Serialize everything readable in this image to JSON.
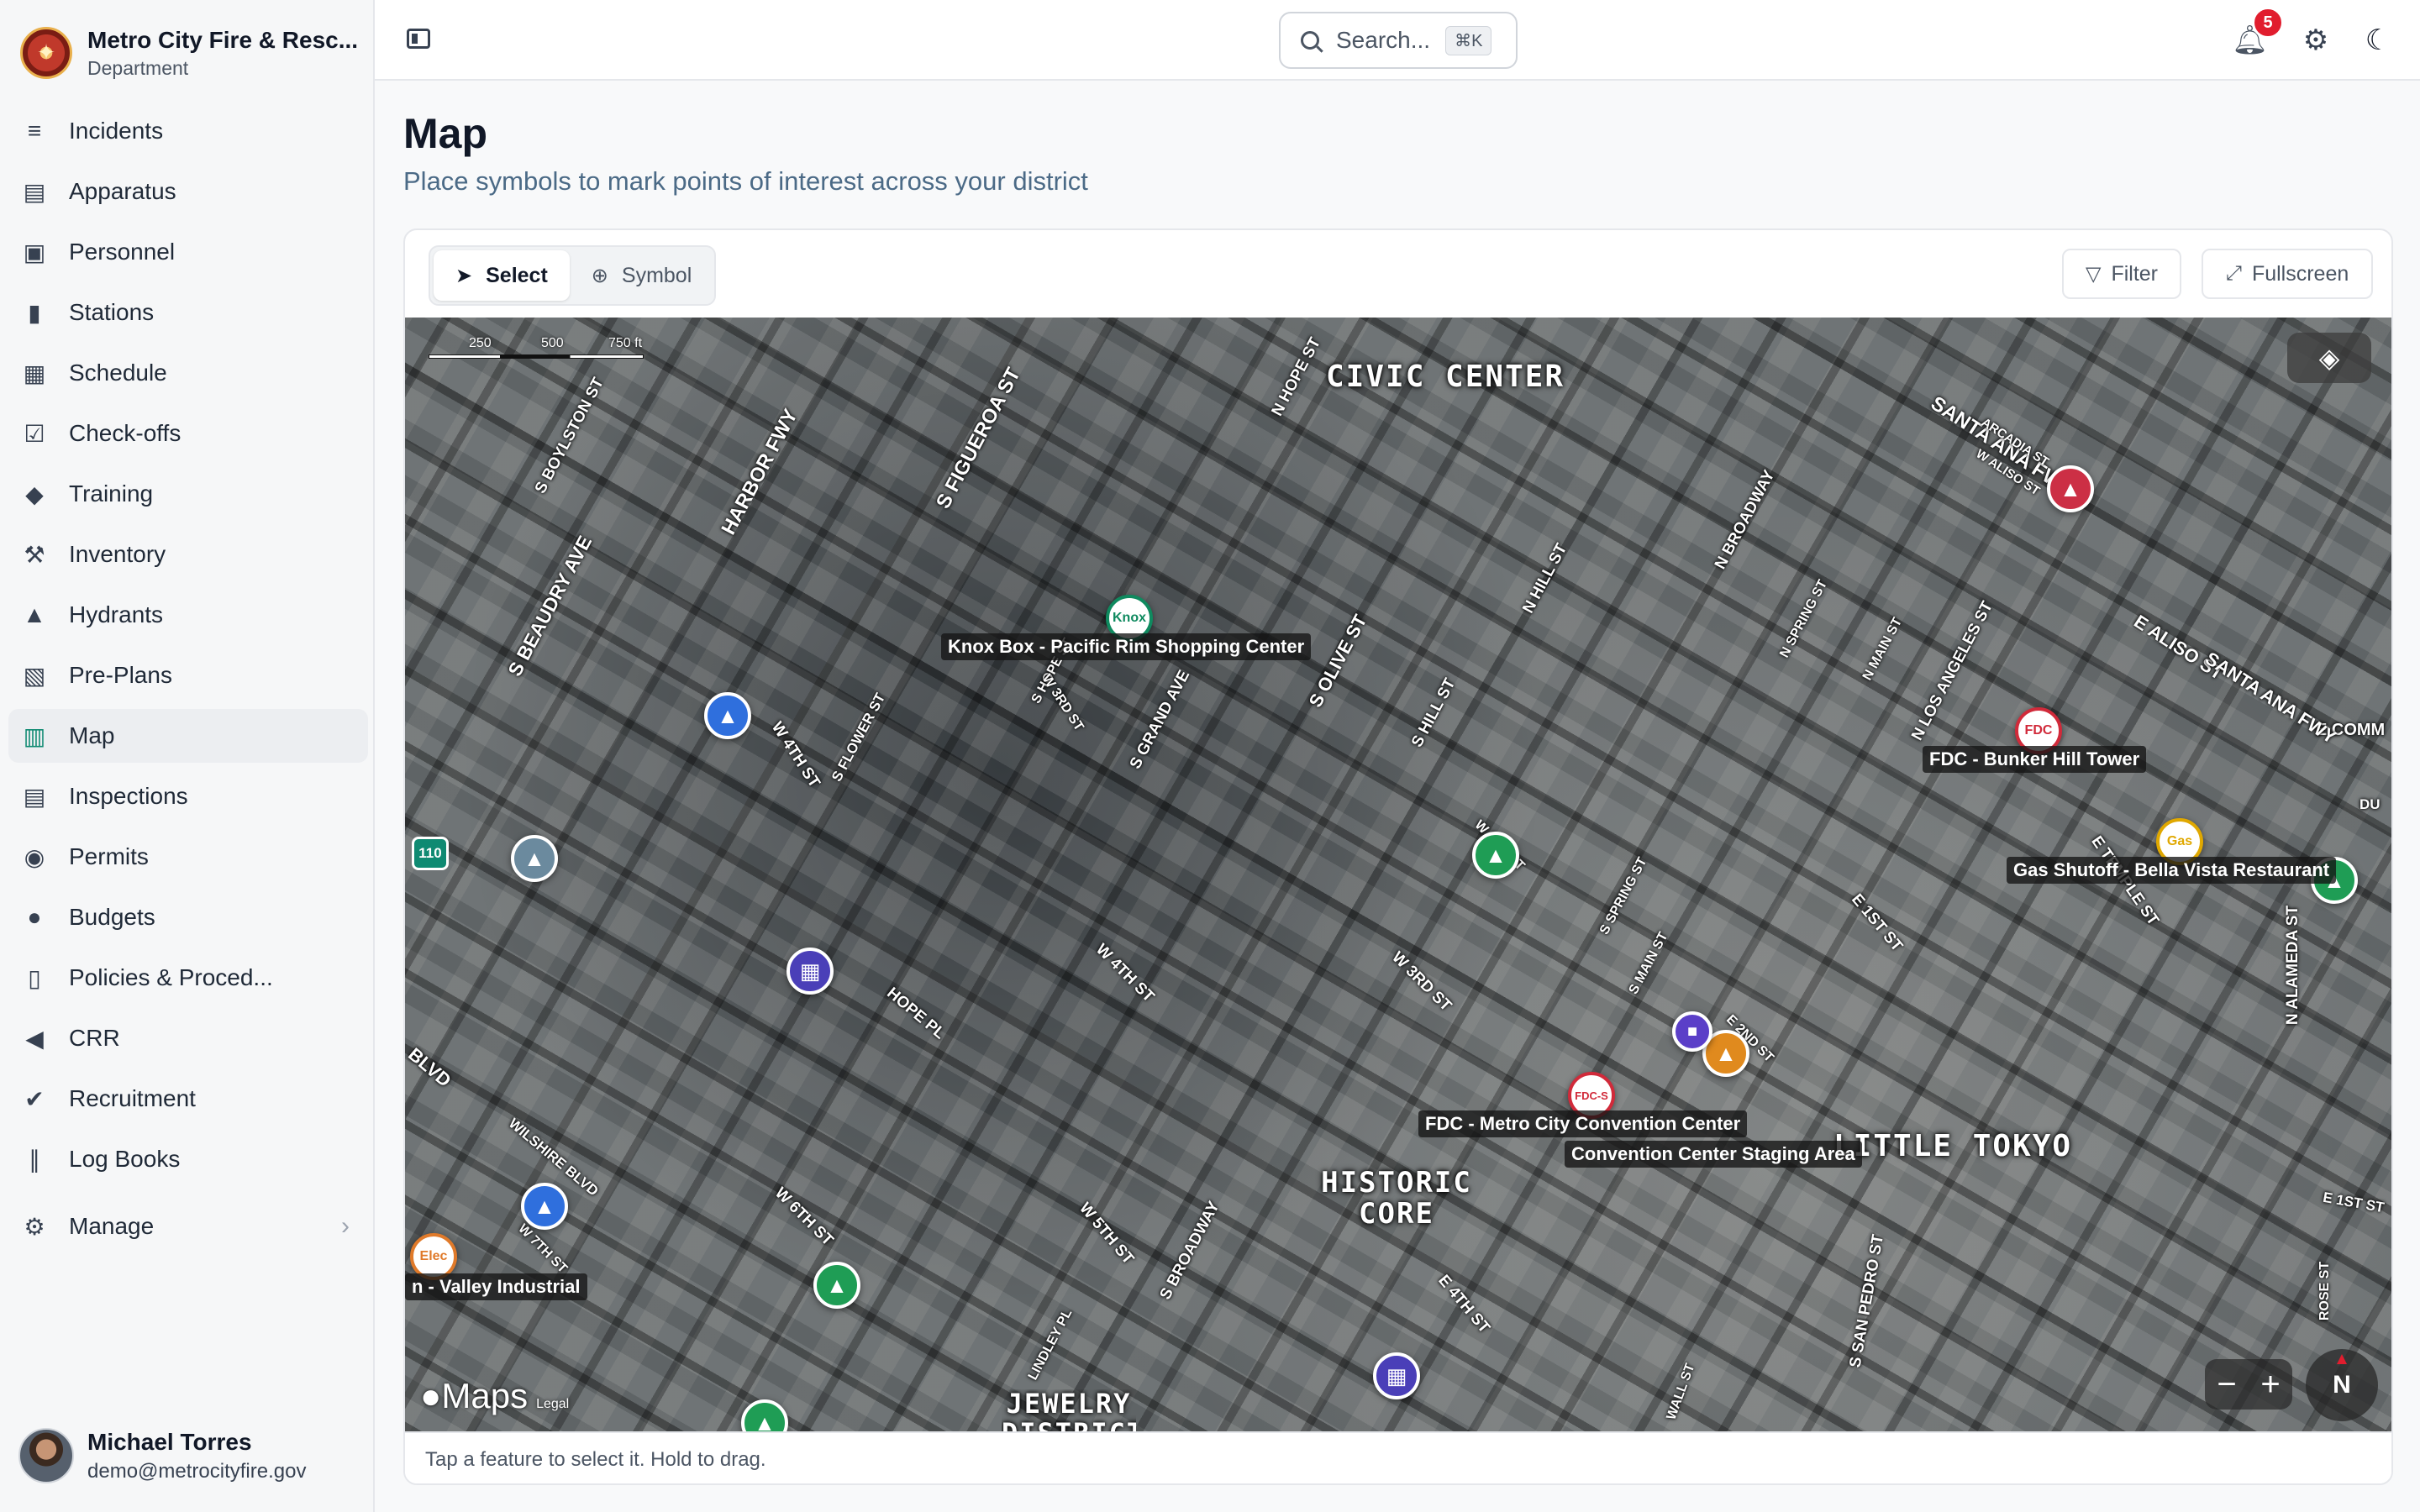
{
  "org": {
    "name": "Metro City Fire & Resc...",
    "subtitle": "Department"
  },
  "nav": {
    "items": [
      {
        "label": "Incidents",
        "icon": "incidents-icon",
        "glyph": "≡"
      },
      {
        "label": "Apparatus",
        "icon": "apparatus-icon",
        "glyph": "▤"
      },
      {
        "label": "Personnel",
        "icon": "personnel-icon",
        "glyph": "▣"
      },
      {
        "label": "Stations",
        "icon": "stations-icon",
        "glyph": "▮"
      },
      {
        "label": "Schedule",
        "icon": "schedule-icon",
        "glyph": "▦"
      },
      {
        "label": "Check-offs",
        "icon": "checkoffs-icon",
        "glyph": "☑"
      },
      {
        "label": "Training",
        "icon": "training-icon",
        "glyph": "◆"
      },
      {
        "label": "Inventory",
        "icon": "inventory-icon",
        "glyph": "⚒"
      },
      {
        "label": "Hydrants",
        "icon": "hydrants-icon",
        "glyph": "▲"
      },
      {
        "label": "Pre-Plans",
        "icon": "preplans-icon",
        "glyph": "▧"
      },
      {
        "label": "Map",
        "icon": "map-icon",
        "glyph": "▥",
        "active": true
      },
      {
        "label": "Inspections",
        "icon": "inspections-icon",
        "glyph": "▤"
      },
      {
        "label": "Permits",
        "icon": "permits-icon",
        "glyph": "◉"
      },
      {
        "label": "Budgets",
        "icon": "budgets-icon",
        "glyph": "●"
      },
      {
        "label": "Policies & Proced...",
        "icon": "policies-icon",
        "glyph": "▯"
      },
      {
        "label": "CRR",
        "icon": "crr-icon",
        "glyph": "◀"
      },
      {
        "label": "Recruitment",
        "icon": "recruitment-icon",
        "glyph": "✔"
      },
      {
        "label": "Log Books",
        "icon": "logbooks-icon",
        "glyph": "∥"
      }
    ],
    "manage": {
      "label": "Manage",
      "icon": "gear-icon",
      "glyph": "⚙",
      "chevron": "›"
    }
  },
  "user": {
    "name": "Michael Torres",
    "email": "demo@metrocityfire.gov"
  },
  "topbar": {
    "search_placeholder": "Search...",
    "search_shortcut": "⌘K",
    "notification_count": "5"
  },
  "page": {
    "title": "Map",
    "subtitle": "Place symbols to mark points of interest across your district"
  },
  "toolbar": {
    "select_label": "Select",
    "symbol_label": "Symbol",
    "filter_label": "Filter",
    "fullscreen_label": "Fullscreen"
  },
  "map": {
    "scale_ticks": [
      "250",
      "500",
      "750 ft"
    ],
    "districts": [
      "CIVIC CENTER",
      "LITTLE TOKYO",
      "HISTORIC CORE",
      "JEWELRY DISTRICT"
    ],
    "streets": [
      "S BOYLSTON ST",
      "HARBOR FWY",
      "S FIGUEROA ST",
      "N HOPE ST",
      "S BEAUDRY AVE",
      "SANTA ANA FWY",
      "ARCADIA ST",
      "W ALISO ST",
      "N BROADWAY",
      "N HILL ST",
      "N SPRING ST",
      "N MAIN ST",
      "N LOS ANGELES ST",
      "E ALISO ST",
      "S OLIVE ST",
      "S HILL ST",
      "S HOPE ST",
      "W 3RD ST",
      "S GRAND AVE",
      "S FLOWER ST",
      "W 4TH ST",
      "HOPE PL",
      "W 4TH ST",
      "W 3RD ST",
      "S MAIN ST",
      "E 2ND ST",
      "E 1ST ST",
      "E TEMPLE ST",
      "N ALAMEDA ST",
      "WILSHIRE BLVD",
      "W 6TH ST",
      "W 7TH ST",
      "W 5TH ST",
      "S BROADWAY",
      "LINDLEY PL",
      "S SAN PEDRO ST",
      "E 4TH ST",
      "WALL ST",
      "ROSE ST",
      "E 1ST ST",
      "BLVD",
      "E COMM",
      "DU",
      "SANTA ANA FWY",
      "W 2ND ST",
      "S SPRING ST"
    ],
    "highway_shield": "110",
    "markers": [
      {
        "kind": "knox-box-marker",
        "text": "Knox",
        "color": "#0f8a5f"
      },
      {
        "kind": "fdc-marker",
        "text": "FDC",
        "color": "#d12a3a"
      },
      {
        "kind": "gas-marker",
        "text": "Gas",
        "color": "#e0a800"
      },
      {
        "kind": "fdc-standpipe-marker",
        "text": "FDC-S",
        "color": "#d12a3a"
      },
      {
        "kind": "electric-marker",
        "text": "Elec",
        "color": "#e07a2a"
      },
      {
        "kind": "hydrant-marker",
        "text": "",
        "color": "#2f6fdd"
      },
      {
        "kind": "hydrant-marker",
        "text": "",
        "color": "#2f6fdd"
      },
      {
        "kind": "hydrant-marker",
        "text": "",
        "color": "#1f9d55"
      },
      {
        "kind": "hydrant-marker",
        "text": "",
        "color": "#1f9d55"
      },
      {
        "kind": "hydrant-marker",
        "text": "",
        "color": "#1f9d55"
      },
      {
        "kind": "hydrant-marker",
        "text": "",
        "color": "#e08a1e"
      },
      {
        "kind": "hydrant-marker",
        "text": "",
        "color": "#cc2f45"
      },
      {
        "kind": "hydrant-marker",
        "text": "",
        "color": "#6b8a9e"
      },
      {
        "kind": "building-marker",
        "text": "",
        "color": "#4a3fb8"
      },
      {
        "kind": "building-marker",
        "text": "",
        "color": "#4a3fb8"
      },
      {
        "kind": "staging-marker",
        "text": "",
        "color": "#5b3fc8"
      },
      {
        "kind": "hydrant-marker",
        "text": "",
        "color": "#1f9d55"
      }
    ],
    "labels": [
      "Knox Box - Pacific Rim Shopping Center",
      "FDC - Bunker Hill Tower",
      "Gas Shutoff - Bella Vista Restaurant",
      "FDC - Metro City Convention Center",
      "Convention Center Staging Area",
      "n - Valley Industrial"
    ],
    "attribution": "Maps",
    "legal": "Legal",
    "compass": "N"
  },
  "footer": {
    "hint": "Tap a feature to select it. Hold to drag."
  }
}
